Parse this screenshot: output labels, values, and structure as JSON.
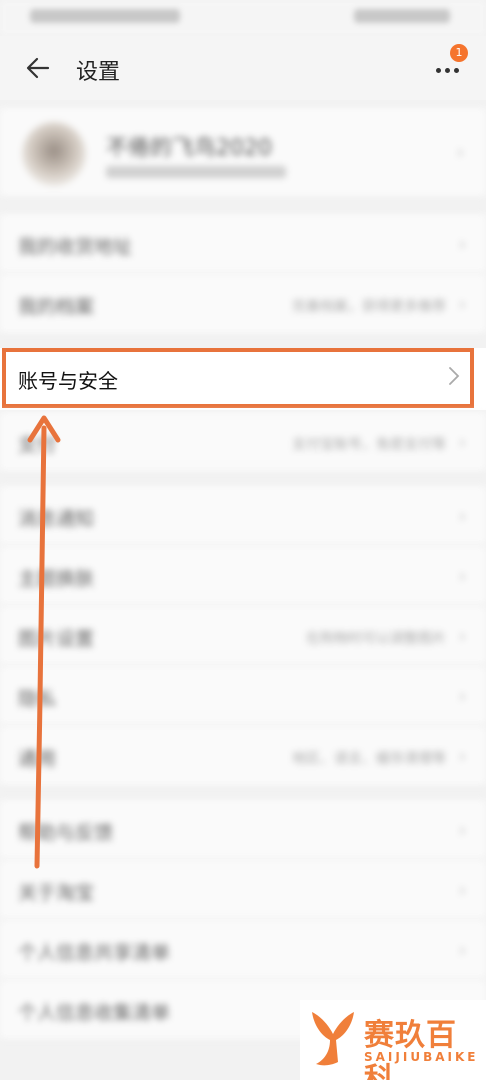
{
  "navbar": {
    "title": "设置",
    "notification_count": "1"
  },
  "profile": {
    "username": "不倦的飞鸟2020"
  },
  "rows": [
    {
      "label": "我的收货地址",
      "value": ""
    },
    {
      "label": "我的档案",
      "value": "完善档案，获得更多推荐"
    },
    {
      "label": "账号与安全",
      "value": ""
    },
    {
      "label": "支付",
      "value": "支付宝账号，免密支付等"
    },
    {
      "label": "消息通知",
      "value": ""
    },
    {
      "label": "主题换肤",
      "value": ""
    },
    {
      "label": "图片设置",
      "value": "在购物时可以调整图片"
    },
    {
      "label": "隐私",
      "value": ""
    },
    {
      "label": "通用",
      "value": "地区、语言、缓存清理等"
    },
    {
      "label": "帮助与反馈",
      "value": ""
    },
    {
      "label": "关于淘宝",
      "value": ""
    },
    {
      "label": "个人信息共享清单",
      "value": ""
    },
    {
      "label": "个人信息收集清单",
      "value": ""
    }
  ],
  "watermark": {
    "brand": "赛玖百科",
    "sub": "SAIJIUBAIKE"
  },
  "colors": {
    "accent": "#e8733c",
    "badge": "#f5742d"
  }
}
